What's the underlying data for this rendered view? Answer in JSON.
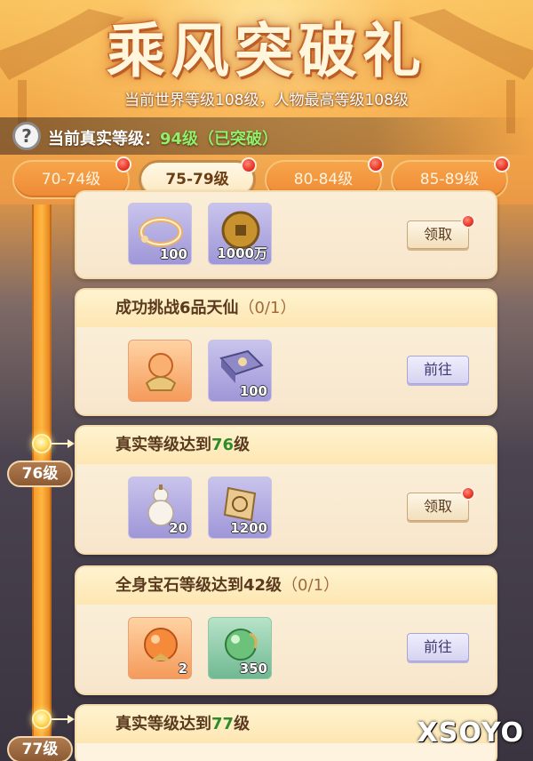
{
  "header": {
    "title": "乘风突破礼",
    "world_level_text": "当前世界等级108级，人物最高等级108级",
    "real_level_label": "当前真实等级：",
    "real_level_value": "94级（已突破）"
  },
  "tabs": [
    {
      "label": "70-74级",
      "active": false,
      "dot": true
    },
    {
      "label": "75-79级",
      "active": true,
      "dot": true
    },
    {
      "label": "80-84级",
      "active": false,
      "dot": true
    },
    {
      "label": "85-89级",
      "active": false,
      "dot": true
    }
  ],
  "timeline": {
    "tags": [
      "76级",
      "77级"
    ]
  },
  "cards": [
    {
      "title_prefix": "",
      "title_highlight": "",
      "title_suffix": "",
      "items": [
        {
          "icon": "bracelet-icon",
          "qty": "100",
          "rarity": "purple"
        },
        {
          "icon": "coin-icon",
          "qty": "1000万",
          "rarity": "purple"
        }
      ],
      "button": "领取"
    },
    {
      "title_prefix": "成功挑战6品天仙",
      "title_highlight": "",
      "title_suffix": "（0/1）",
      "items": [
        {
          "icon": "orb-pouch-icon",
          "qty": "",
          "rarity": "orange"
        },
        {
          "icon": "book-icon",
          "qty": "100",
          "rarity": "purple"
        }
      ],
      "button": "前往"
    },
    {
      "title_prefix": "真实等级达到",
      "title_highlight": "76",
      "title_suffix": "级",
      "items": [
        {
          "icon": "gourd-icon",
          "qty": "20",
          "rarity": "purple"
        },
        {
          "icon": "scroll-token-icon",
          "qty": "1200",
          "rarity": "purple"
        }
      ],
      "button": "领取"
    },
    {
      "title_prefix": "全身宝石等级达到42级",
      "title_highlight": "",
      "title_suffix": "（0/1）",
      "items": [
        {
          "icon": "orange-gem-icon",
          "qty": "2",
          "rarity": "orange"
        },
        {
          "icon": "green-gem-icon",
          "qty": "350",
          "rarity": "green"
        }
      ],
      "button": "前往"
    },
    {
      "title_prefix": "真实等级达到",
      "title_highlight": "77",
      "title_suffix": "级"
    }
  ],
  "watermark": "XSOYO"
}
